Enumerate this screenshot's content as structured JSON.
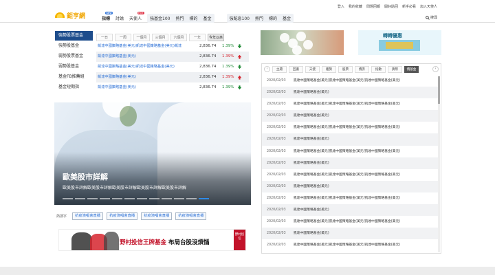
{
  "header": {
    "logo_text": "鉅亨網",
    "nav": [
      {
        "label": "指標",
        "badge": "new",
        "bold": true
      },
      {
        "label": "討論",
        "badge": "",
        "bold": false
      },
      {
        "label": "天使人",
        "badge": "HOT",
        "bold": false
      }
    ],
    "group1": [
      {
        "label": "強基金100"
      },
      {
        "label": "熱門"
      },
      {
        "label": "標的"
      },
      {
        "label": "基金"
      }
    ],
    "group2": [
      {
        "label": "強配息100"
      },
      {
        "label": "熱門"
      },
      {
        "label": "標的"
      },
      {
        "label": "基金"
      }
    ],
    "top_links": [
      "登入",
      "我的收藏",
      "問題回報",
      "開好貼回",
      "新手必看",
      "加入天使人"
    ],
    "search_label": "搜尋"
  },
  "fund_panel": {
    "side_items": [
      "強勢股票基金",
      "強勢股基金",
      "弱勢股票基金",
      "弱勢股基金",
      "基金FB推薦組",
      "基金短期指"
    ],
    "active_side": 0,
    "period_tabs": [
      "一日",
      "一周",
      "一個月",
      "三個月",
      "六個月",
      "一年",
      "今年以來"
    ],
    "active_period": 6,
    "rows": [
      {
        "name": "凱達中國策略基金(美元)凱達中國策略基金(美元)凱達",
        "price": "2,836.74",
        "change": "1.39%",
        "dir": "down"
      },
      {
        "name": "凱達中國策略基金(美元)",
        "price": "2,836.74",
        "change": "1.39%",
        "dir": "up"
      },
      {
        "name": "凱達中國策略基金(美元)凱達中國策略基金(美元)",
        "price": "2,836.74",
        "change": "1.39%",
        "dir": "down"
      },
      {
        "name": "凱達中國策略基金(美元)",
        "price": "2,836.74",
        "change": "1.39%",
        "dir": "up"
      },
      {
        "name": "凱達中國策略基金(美元)",
        "price": "2,836.74",
        "change": "1.39%",
        "dir": "down"
      }
    ]
  },
  "hero": {
    "title": "歐美股市詳解",
    "subtitle": "歐美股市詳解歐美股市詳解歐美股市詳解歐美股市詳解歐美股市詳解",
    "dot_count": 12,
    "active_dot": 11
  },
  "hot_tags": {
    "label": "熱搜字",
    "tags": [
      "抗疫演唱會直播",
      "抗疫演唱會直播",
      "抗疫演唱會直播",
      "抗疫演唱會直播"
    ]
  },
  "ad": {
    "text_red": "野村投信王牌基金",
    "text_black": "布局台股沒煩惱",
    "logo_text": "野村投信"
  },
  "banners": {
    "banner2_text": "轉轉優惠"
  },
  "news": {
    "tabs": [
      "主題",
      "回書",
      "天使",
      "趨勢",
      "股票",
      "債券",
      "指數",
      "貨幣",
      "債基金"
    ],
    "active_tab": 8,
    "rows": [
      {
        "date": "2020/02/03",
        "title": "凱達中國策略基金(美元)凱達中國策略基金(美元)凱達中國策略基金(美元)"
      },
      {
        "date": "2020/02/03",
        "title": "凱達中國策略基金(美元)"
      },
      {
        "date": "2020/02/03",
        "title": "凱達中國策略基金(美元)凱達中國策略基金(美元)凱達中國策略基金(美元)"
      },
      {
        "date": "2020/02/03",
        "title": "凱達中國策略基金(美元)"
      },
      {
        "date": "2020/02/03",
        "title": "凱達中國策略基金(美元)凱達中國策略基金(美元)凱達中國策略基金(美元)"
      },
      {
        "date": "2020/02/03",
        "title": "凱達中國策略基金(美元)"
      },
      {
        "date": "2020/02/03",
        "title": "凱達中國策略基金(美元)凱達中國策略基金(美元)凱達中國策略基金(美元)"
      },
      {
        "date": "2020/02/03",
        "title": "凱達中國策略基金(美元)"
      },
      {
        "date": "2020/02/03",
        "title": "凱達中國策略基金(美元)凱達中國策略基金(美元)凱達中國策略基金(美元)"
      },
      {
        "date": "2020/02/03",
        "title": "凱達中國策略基金(美元)"
      },
      {
        "date": "2020/02/03",
        "title": "凱達中國策略基金(美元)凱達中國策略基金(美元)凱達中國策略基金(美元)"
      },
      {
        "date": "2020/02/03",
        "title": "凱達中國策略基金(美元)"
      },
      {
        "date": "2020/02/03",
        "title": "凱達中國策略基金(美元)凱達中國策略基金(美元)凱達中國策略基金(美元)"
      },
      {
        "date": "2020/02/03",
        "title": "凱達中國策略基金(美元)"
      },
      {
        "date": "2020/02/03",
        "title": "凱達中國策略基金(美元)凱達中國策略基金(美元)凱達中國策略基金(美元)"
      }
    ]
  },
  "colors": {
    "accent_blue": "#2a6fd6",
    "side_active": "#1e4d8c",
    "up_green": "#1e8a36",
    "down_red": "#d6242e"
  }
}
